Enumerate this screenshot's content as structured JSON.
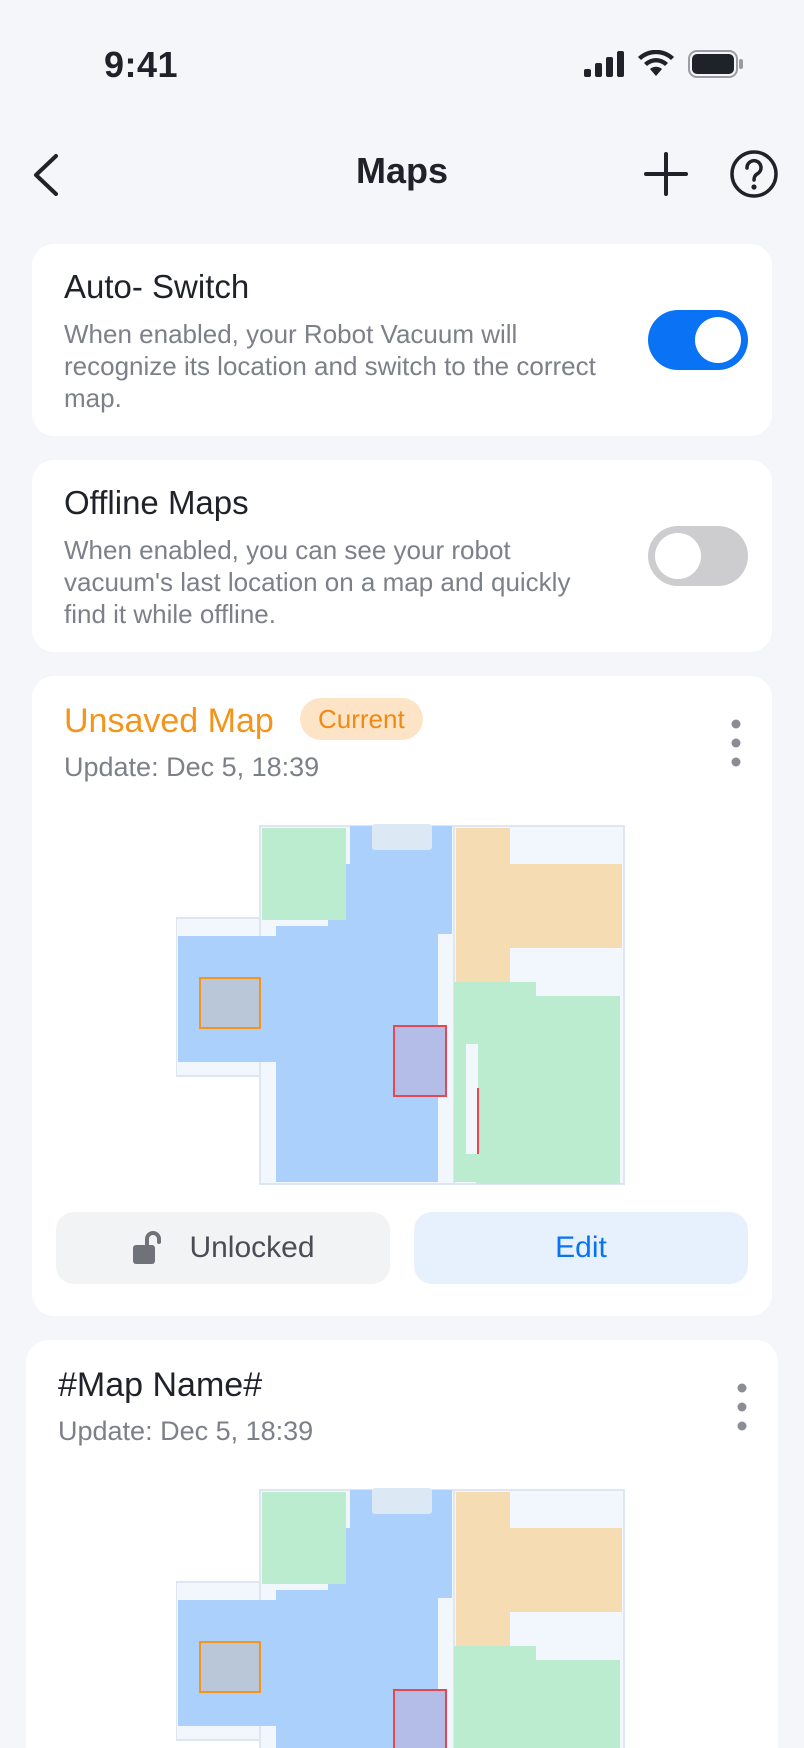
{
  "status_bar": {
    "time": "9:41"
  },
  "nav": {
    "title": "Maps"
  },
  "settings": [
    {
      "title": "Auto- Switch",
      "description": "When enabled, your Robot Vacuum will recognize its location and switch to the correct map.",
      "enabled": true
    },
    {
      "title": "Offline Maps",
      "description": "When enabled, you can see your robot vacuum's last location on a map and quickly find it while offline.",
      "enabled": false
    }
  ],
  "maps": [
    {
      "name": "Unsaved Map",
      "badge": "Current",
      "updated": "Update: Dec 5, 18:39",
      "lock_label": "Unlocked",
      "edit_label": "Edit"
    },
    {
      "name": "#Map Name#",
      "updated": "Update: Dec 5, 18:39"
    }
  ],
  "colors": {
    "accent": "#0a72f5",
    "unsaved": "#f4941b",
    "room_blue": "#aad0fb",
    "room_green": "#bcecd0",
    "room_orange": "#f6dcb3",
    "no_go_zone": "#e8474f",
    "carpet_zone": "#f4941b"
  }
}
